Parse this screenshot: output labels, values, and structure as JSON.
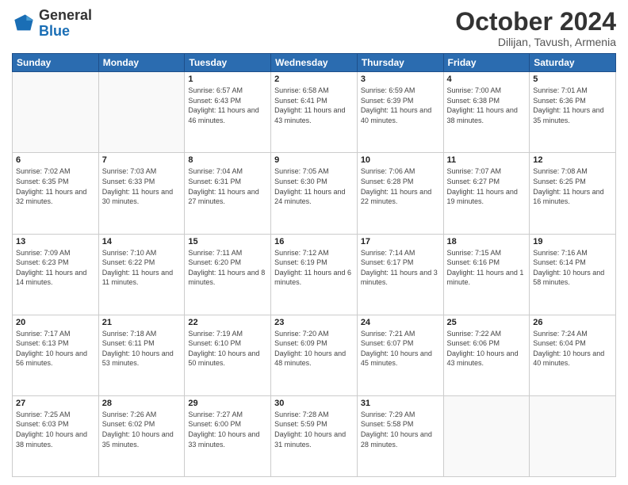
{
  "header": {
    "logo_general": "General",
    "logo_blue": "Blue",
    "month": "October 2024",
    "location": "Dilijan, Tavush, Armenia"
  },
  "weekdays": [
    "Sunday",
    "Monday",
    "Tuesday",
    "Wednesday",
    "Thursday",
    "Friday",
    "Saturday"
  ],
  "weeks": [
    [
      {
        "day": "",
        "info": ""
      },
      {
        "day": "",
        "info": ""
      },
      {
        "day": "1",
        "info": "Sunrise: 6:57 AM\nSunset: 6:43 PM\nDaylight: 11 hours and 46 minutes."
      },
      {
        "day": "2",
        "info": "Sunrise: 6:58 AM\nSunset: 6:41 PM\nDaylight: 11 hours and 43 minutes."
      },
      {
        "day": "3",
        "info": "Sunrise: 6:59 AM\nSunset: 6:39 PM\nDaylight: 11 hours and 40 minutes."
      },
      {
        "day": "4",
        "info": "Sunrise: 7:00 AM\nSunset: 6:38 PM\nDaylight: 11 hours and 38 minutes."
      },
      {
        "day": "5",
        "info": "Sunrise: 7:01 AM\nSunset: 6:36 PM\nDaylight: 11 hours and 35 minutes."
      }
    ],
    [
      {
        "day": "6",
        "info": "Sunrise: 7:02 AM\nSunset: 6:35 PM\nDaylight: 11 hours and 32 minutes."
      },
      {
        "day": "7",
        "info": "Sunrise: 7:03 AM\nSunset: 6:33 PM\nDaylight: 11 hours and 30 minutes."
      },
      {
        "day": "8",
        "info": "Sunrise: 7:04 AM\nSunset: 6:31 PM\nDaylight: 11 hours and 27 minutes."
      },
      {
        "day": "9",
        "info": "Sunrise: 7:05 AM\nSunset: 6:30 PM\nDaylight: 11 hours and 24 minutes."
      },
      {
        "day": "10",
        "info": "Sunrise: 7:06 AM\nSunset: 6:28 PM\nDaylight: 11 hours and 22 minutes."
      },
      {
        "day": "11",
        "info": "Sunrise: 7:07 AM\nSunset: 6:27 PM\nDaylight: 11 hours and 19 minutes."
      },
      {
        "day": "12",
        "info": "Sunrise: 7:08 AM\nSunset: 6:25 PM\nDaylight: 11 hours and 16 minutes."
      }
    ],
    [
      {
        "day": "13",
        "info": "Sunrise: 7:09 AM\nSunset: 6:23 PM\nDaylight: 11 hours and 14 minutes."
      },
      {
        "day": "14",
        "info": "Sunrise: 7:10 AM\nSunset: 6:22 PM\nDaylight: 11 hours and 11 minutes."
      },
      {
        "day": "15",
        "info": "Sunrise: 7:11 AM\nSunset: 6:20 PM\nDaylight: 11 hours and 8 minutes."
      },
      {
        "day": "16",
        "info": "Sunrise: 7:12 AM\nSunset: 6:19 PM\nDaylight: 11 hours and 6 minutes."
      },
      {
        "day": "17",
        "info": "Sunrise: 7:14 AM\nSunset: 6:17 PM\nDaylight: 11 hours and 3 minutes."
      },
      {
        "day": "18",
        "info": "Sunrise: 7:15 AM\nSunset: 6:16 PM\nDaylight: 11 hours and 1 minute."
      },
      {
        "day": "19",
        "info": "Sunrise: 7:16 AM\nSunset: 6:14 PM\nDaylight: 10 hours and 58 minutes."
      }
    ],
    [
      {
        "day": "20",
        "info": "Sunrise: 7:17 AM\nSunset: 6:13 PM\nDaylight: 10 hours and 56 minutes."
      },
      {
        "day": "21",
        "info": "Sunrise: 7:18 AM\nSunset: 6:11 PM\nDaylight: 10 hours and 53 minutes."
      },
      {
        "day": "22",
        "info": "Sunrise: 7:19 AM\nSunset: 6:10 PM\nDaylight: 10 hours and 50 minutes."
      },
      {
        "day": "23",
        "info": "Sunrise: 7:20 AM\nSunset: 6:09 PM\nDaylight: 10 hours and 48 minutes."
      },
      {
        "day": "24",
        "info": "Sunrise: 7:21 AM\nSunset: 6:07 PM\nDaylight: 10 hours and 45 minutes."
      },
      {
        "day": "25",
        "info": "Sunrise: 7:22 AM\nSunset: 6:06 PM\nDaylight: 10 hours and 43 minutes."
      },
      {
        "day": "26",
        "info": "Sunrise: 7:24 AM\nSunset: 6:04 PM\nDaylight: 10 hours and 40 minutes."
      }
    ],
    [
      {
        "day": "27",
        "info": "Sunrise: 7:25 AM\nSunset: 6:03 PM\nDaylight: 10 hours and 38 minutes."
      },
      {
        "day": "28",
        "info": "Sunrise: 7:26 AM\nSunset: 6:02 PM\nDaylight: 10 hours and 35 minutes."
      },
      {
        "day": "29",
        "info": "Sunrise: 7:27 AM\nSunset: 6:00 PM\nDaylight: 10 hours and 33 minutes."
      },
      {
        "day": "30",
        "info": "Sunrise: 7:28 AM\nSunset: 5:59 PM\nDaylight: 10 hours and 31 minutes."
      },
      {
        "day": "31",
        "info": "Sunrise: 7:29 AM\nSunset: 5:58 PM\nDaylight: 10 hours and 28 minutes."
      },
      {
        "day": "",
        "info": ""
      },
      {
        "day": "",
        "info": ""
      }
    ]
  ]
}
